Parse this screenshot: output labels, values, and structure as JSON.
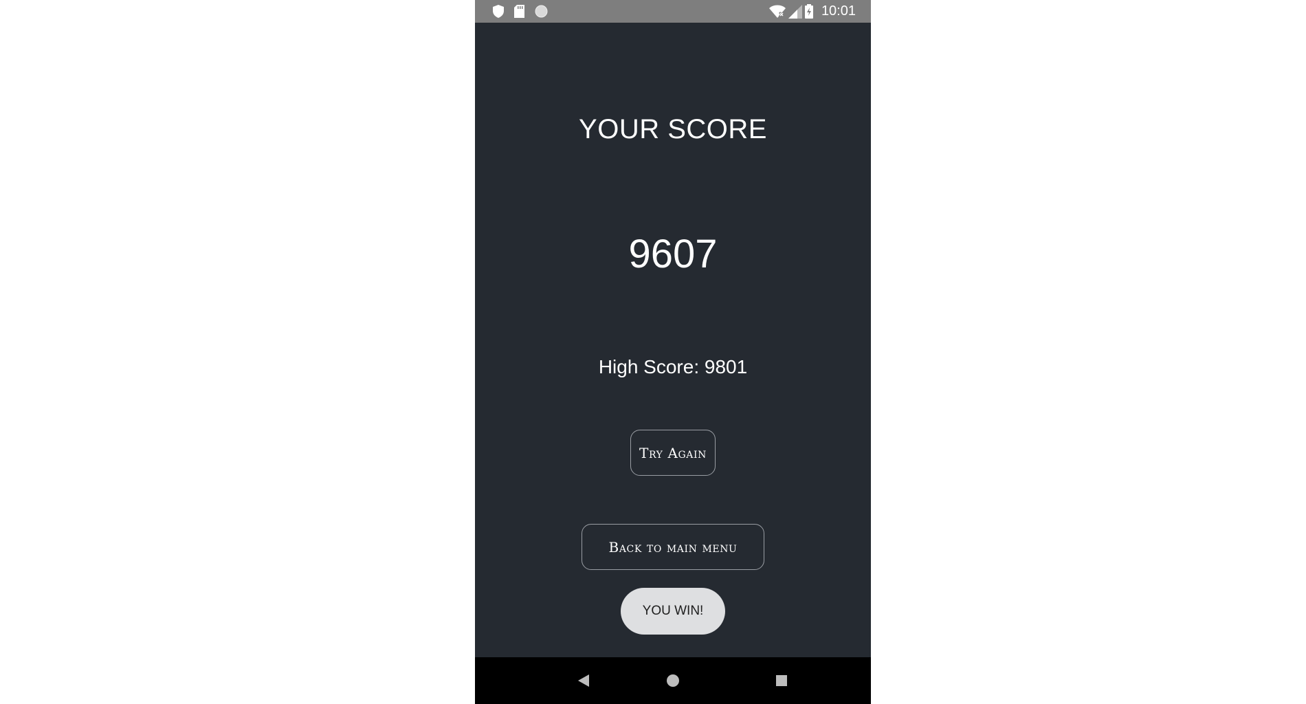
{
  "status_bar": {
    "time": "10:01",
    "left_icons": [
      "shield-icon",
      "sd-card-icon",
      "circle-icon"
    ],
    "right_icons": [
      "wifi-off-icon",
      "signal-icon",
      "battery-charging-icon"
    ]
  },
  "score_screen": {
    "title": "YOUR SCORE",
    "score": "9607",
    "high_score_text": "High Score: 9801"
  },
  "buttons": {
    "try_again": "Try Again",
    "back_to_main_menu": "Back to main menu",
    "you_win": "YOU WIN!"
  },
  "nav_bar": {
    "icons": [
      "back-icon",
      "home-icon",
      "recent-apps-icon"
    ]
  },
  "colors": {
    "background": "#252a31",
    "status_bar": "#7e7e7e",
    "nav_bar": "#000000",
    "win_button": "#dedfe1",
    "text": "#ffffff"
  }
}
